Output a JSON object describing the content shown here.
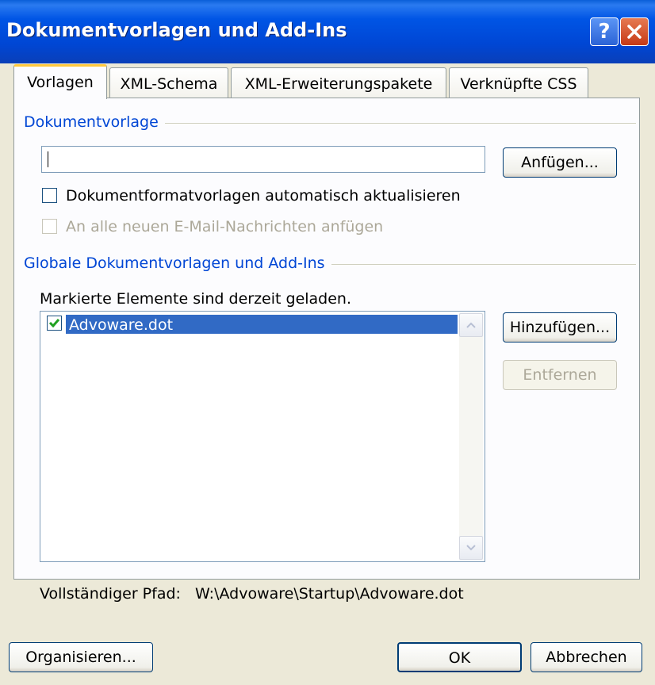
{
  "window": {
    "title": "Dokumentvorlagen und Add-Ins",
    "help": "?"
  },
  "tabs": [
    {
      "label": "Vorlagen"
    },
    {
      "label": "XML-Schema"
    },
    {
      "label": "XML-Erweiterungspakete"
    },
    {
      "label": "Verknüpfte CSS"
    }
  ],
  "document_template": {
    "group_label": "Dokumentvorlage",
    "path_value": "",
    "attach_button": "Anfügen...",
    "auto_update_label": "Dokumentformatvorlagen automatisch aktualisieren",
    "auto_update_checked": false,
    "email_label": "An alle neuen E-Mail-Nachrichten anfügen",
    "email_enabled": false
  },
  "global_templates": {
    "group_label": "Globale Dokumentvorlagen und Add-Ins",
    "info_text": "Markierte Elemente sind derzeit geladen.",
    "items": [
      {
        "name": "Advoware.dot",
        "checked": true,
        "selected": true
      }
    ],
    "add_button": "Hinzufügen...",
    "remove_button": "Entfernen",
    "full_path_label": "Vollständiger Pfad:",
    "full_path_value": "W:\\Advoware\\Startup\\Advoware.dot"
  },
  "footer": {
    "organize_button": "Organisieren...",
    "ok_button": "OK",
    "cancel_button": "Abbrechen"
  },
  "colors": {
    "titlebar": "#0055e5",
    "selection": "#316ac5",
    "group_label": "#0046d5",
    "dialog_bg": "#ece9d8"
  }
}
